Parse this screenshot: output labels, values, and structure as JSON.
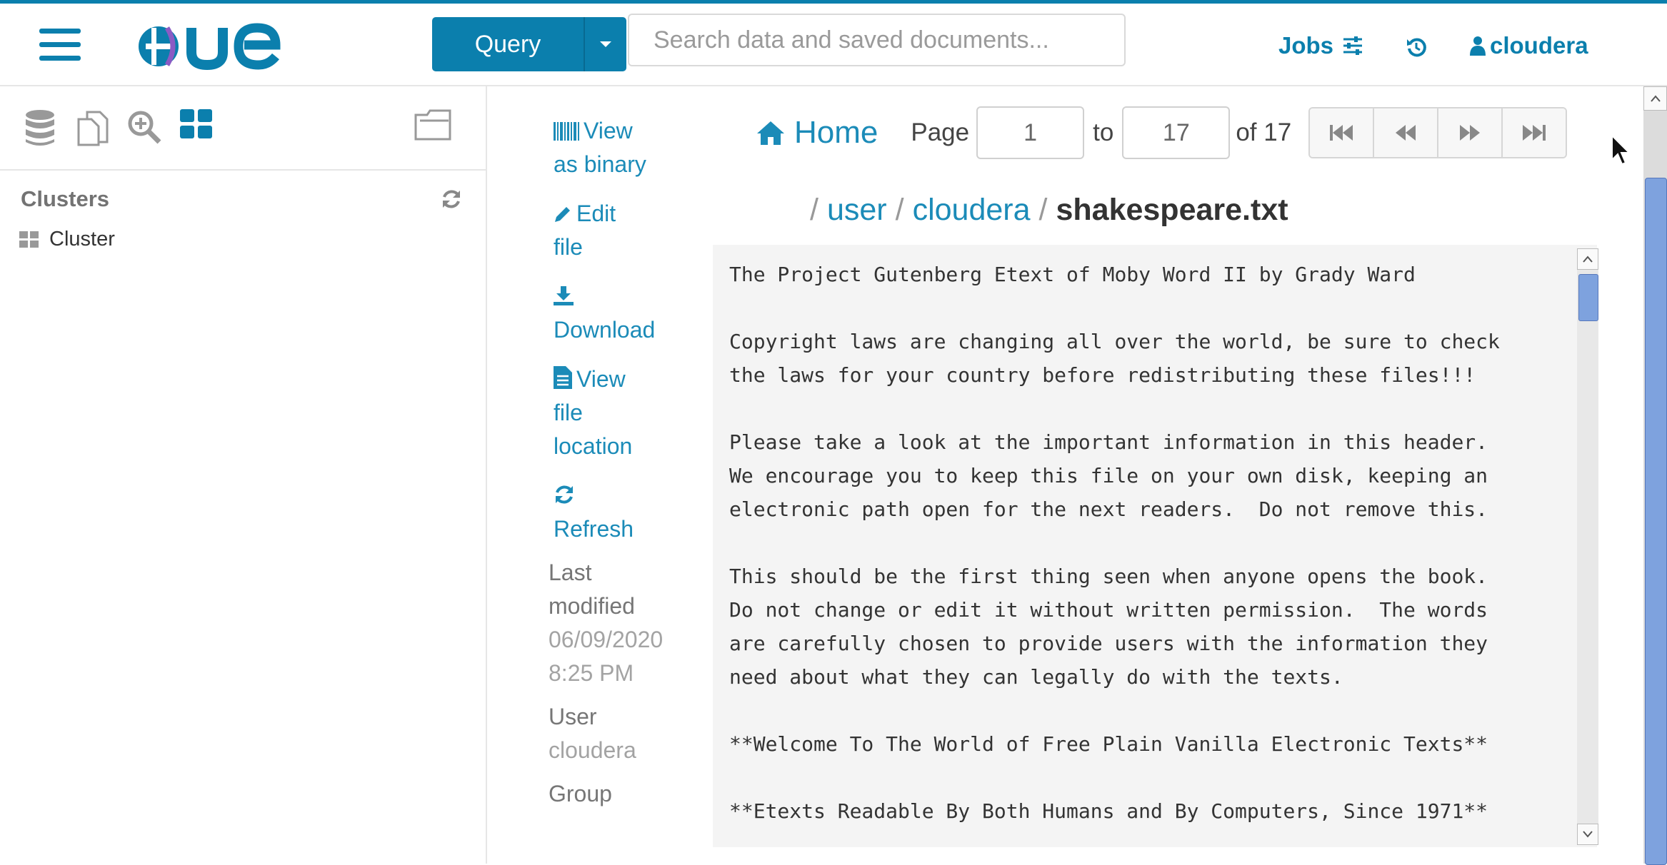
{
  "header": {
    "logo_alt": "HUE",
    "query_label": "Query",
    "search_placeholder": "Search data and saved documents...",
    "jobs_label": "Jobs",
    "user_label": "cloudera"
  },
  "sidebar": {
    "clusters_heading": "Clusters",
    "items": [
      {
        "label": "Cluster"
      }
    ]
  },
  "actions": {
    "view_binary": [
      "View",
      "as binary"
    ],
    "edit_file": [
      "Edit",
      "file"
    ],
    "download": "Download",
    "view_location": [
      "View",
      "file",
      "location"
    ],
    "refresh": "Refresh",
    "last_modified_label": [
      "Last",
      "modified"
    ],
    "last_modified_value": [
      "06/09/2020",
      "8:25 PM"
    ],
    "user_label": "User",
    "user_value": "cloudera",
    "group_label": "Group"
  },
  "pager": {
    "home": "Home",
    "page_label": "Page",
    "from": "1",
    "to_label": "to",
    "to": "17",
    "of_label": "of 17"
  },
  "breadcrumb": {
    "sep": "/",
    "parts": [
      "user",
      "cloudera"
    ],
    "current": "shakespeare.txt"
  },
  "file_content": "The Project Gutenberg Etext of Moby Word II by Grady Ward\n\nCopyright laws are changing all over the world, be sure to check\nthe laws for your country before redistributing these files!!!\n\nPlease take a look at the important information in this header.\nWe encourage you to keep this file on your own disk, keeping an\nelectronic path open for the next readers.  Do not remove this.\n\nThis should be the first thing seen when anyone opens the book.\nDo not change or edit it without written permission.  The words\nare carefully chosen to provide users with the information they\nneed about what they can legally do with the texts.\n\n**Welcome To The World of Free Plain Vanilla Electronic Texts**\n\n**Etexts Readable By Both Humans and By Computers, Since 1971**",
  "colors": {
    "accent": "#0B7FAD",
    "link": "#1b8bb8",
    "scroll_thumb": "#7ea2de"
  }
}
